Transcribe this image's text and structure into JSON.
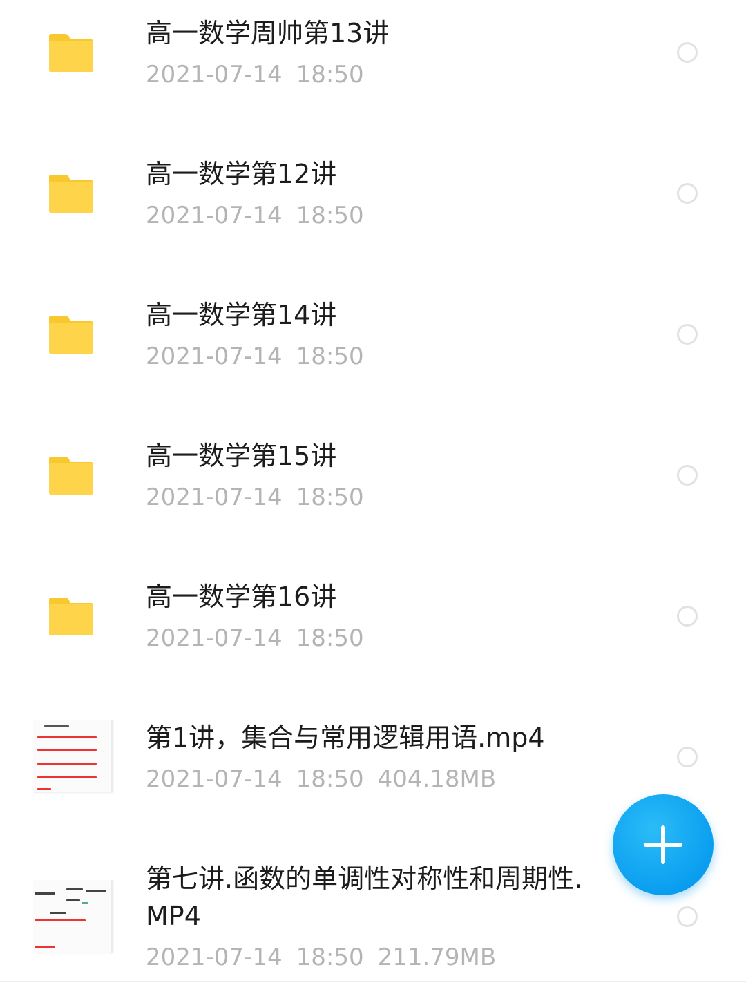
{
  "files": [
    {
      "type": "folder",
      "name": "高一数学周帅第13讲",
      "date": "2021-07-14",
      "time": "18:50",
      "size": ""
    },
    {
      "type": "folder",
      "name": "高一数学第12讲",
      "date": "2021-07-14",
      "time": "18:50",
      "size": ""
    },
    {
      "type": "folder",
      "name": "高一数学第14讲",
      "date": "2021-07-14",
      "time": "18:50",
      "size": ""
    },
    {
      "type": "folder",
      "name": "高一数学第15讲",
      "date": "2021-07-14",
      "time": "18:50",
      "size": ""
    },
    {
      "type": "folder",
      "name": "高一数学第16讲",
      "date": "2021-07-14",
      "time": "18:50",
      "size": ""
    },
    {
      "type": "video",
      "name": "第1讲，集合与常用逻辑用语.mp4",
      "date": "2021-07-14",
      "time": "18:50",
      "size": "404.18MB"
    },
    {
      "type": "video",
      "name": "第七讲.函数的单调性对称性和周期性.MP4",
      "date": "2021-07-14",
      "time": "18:50",
      "size": "211.79MB"
    }
  ],
  "icons": {
    "folder": "folder-icon",
    "video": "video-thumbnail",
    "select": "radio-circle-icon",
    "fab": "plus-icon"
  },
  "colors": {
    "folder": "#fed54a",
    "folder_tab": "#f8c92f",
    "fab": "#0a9ef0",
    "title": "#1c1c1c",
    "meta": "#b4b4b4"
  }
}
